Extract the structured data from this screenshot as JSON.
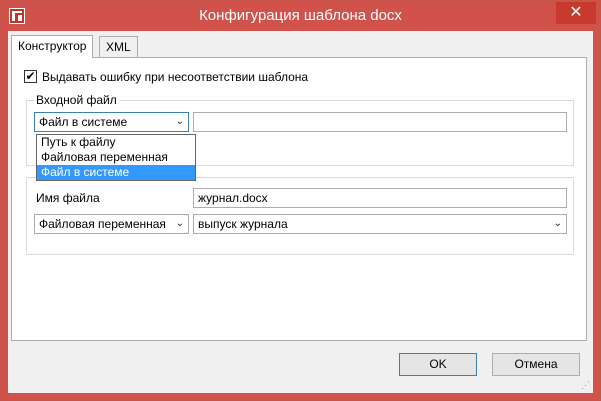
{
  "window": {
    "title": "Конфигурация шаблона docx",
    "close_glyph": "✕"
  },
  "tabs": [
    {
      "label": "Конструктор",
      "active": true
    },
    {
      "label": "XML",
      "active": false
    }
  ],
  "checkbox": {
    "checked": true,
    "label": "Выдавать ошибку при несоответствии шаблона"
  },
  "input_group": {
    "label": "Входной файл",
    "source_combo": {
      "value": "Файл в системе"
    },
    "path_value": "",
    "dropdown_options": [
      "Путь к файлу",
      "Файловая переменная",
      "Файл в системе"
    ],
    "dropdown_selected_index": 2
  },
  "output_group": {
    "filename_label": "Имя файла",
    "filename_value": "журнал.docx",
    "kind_combo": {
      "value": "Файловая переменная"
    },
    "variable_combo": {
      "value": "выпуск журнала"
    }
  },
  "buttons": {
    "ok": "OK",
    "cancel": "Отмена"
  },
  "colors": {
    "title_bar": "#d1524a",
    "selection": "#3399ff",
    "close_button": "#c7392d"
  }
}
